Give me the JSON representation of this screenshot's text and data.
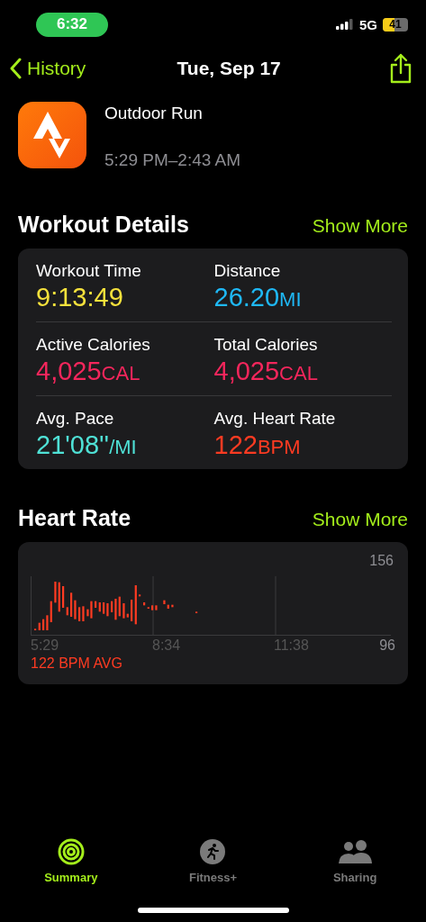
{
  "status_bar": {
    "time": "6:32",
    "network": "5G",
    "battery": "41"
  },
  "nav": {
    "back": "History",
    "title": "Tue, Sep 17"
  },
  "workout": {
    "name": "Outdoor Run",
    "time_range": "5:29 PM–2:43 AM"
  },
  "details": {
    "title": "Workout Details",
    "action": "Show More",
    "metrics": [
      {
        "label": "Workout Time",
        "value": "9:13:49",
        "color": "#f6e23c"
      },
      {
        "label": "Distance",
        "value": "26.20",
        "unit": "MI",
        "color": "#1fb9f7"
      },
      {
        "label": "Active Calories",
        "value": "4,025",
        "unit": "CAL",
        "color": "#f4265c"
      },
      {
        "label": "Total Calories",
        "value": "4,025",
        "unit": "CAL",
        "color": "#f4265c"
      },
      {
        "label": "Avg. Pace",
        "value": "21'08''",
        "unit": "/MI",
        "color": "#4fe1d6"
      },
      {
        "label": "Avg. Heart Rate",
        "value": "122",
        "unit": "BPM",
        "color": "#ff3b22"
      }
    ]
  },
  "heart_rate": {
    "title": "Heart Rate",
    "action": "Show More",
    "y_max": "156",
    "y_min": "96",
    "x_labels": [
      "5:29",
      "8:34",
      "11:38"
    ],
    "average": "122 BPM AVG"
  },
  "tabs": [
    {
      "label": "Summary",
      "selected": true
    },
    {
      "label": "Fitness+",
      "selected": false
    },
    {
      "label": "Sharing",
      "selected": false
    }
  ]
}
